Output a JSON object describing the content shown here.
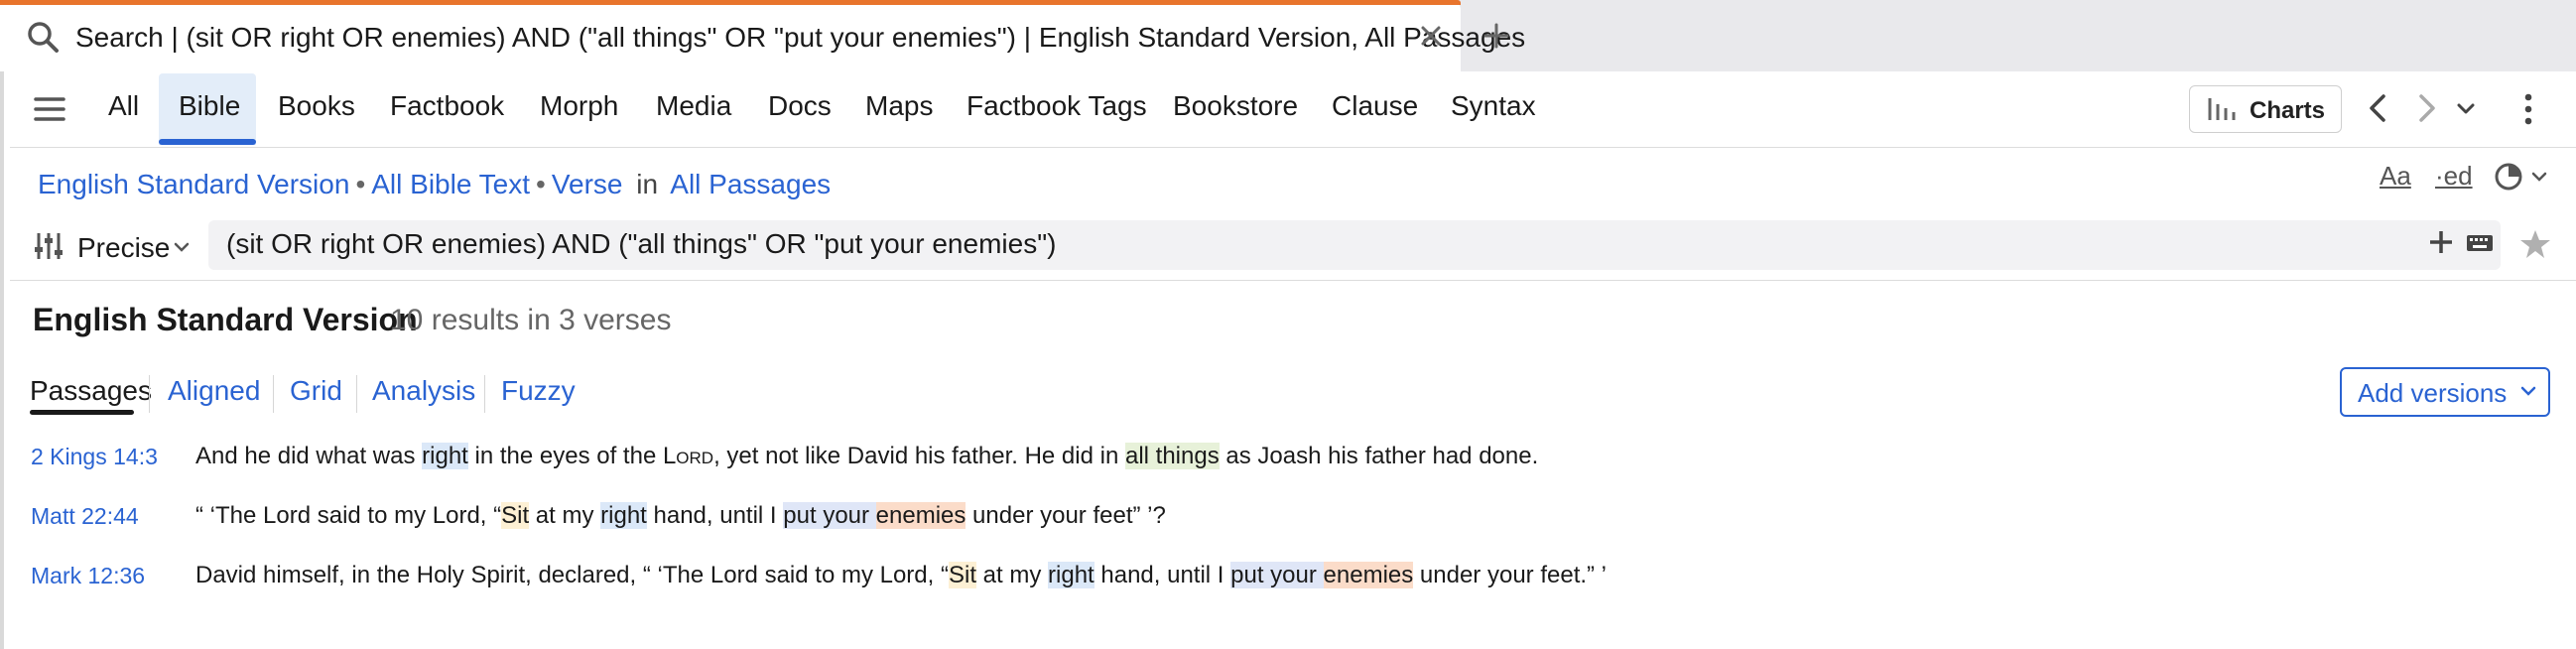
{
  "tab": {
    "title": "Search | (sit OR right OR enemies) AND (\"all things\" OR \"put your enemies\") | English Standard Version, All Passages"
  },
  "nav": {
    "tabs": [
      "All",
      "Bible",
      "Books",
      "Factbook",
      "Morph",
      "Media",
      "Docs",
      "Maps",
      "Factbook Tags",
      "Bookstore",
      "Clause",
      "Syntax"
    ],
    "active": "Bible",
    "charts_label": "Charts"
  },
  "breadcrumb": {
    "version": "English Standard Version",
    "scope": "All Bible Text",
    "unit": "Verse",
    "in_label": "in",
    "range": "All Passages"
  },
  "search": {
    "mode": "Precise",
    "query": "(sit OR right OR enemies) AND (\"all things\" OR \"put your enemies\")"
  },
  "results": {
    "title": "English Standard Version",
    "count": "10 results in 3 verses"
  },
  "view_tabs": [
    "Passages",
    "Aligned",
    "Grid",
    "Analysis",
    "Fuzzy"
  ],
  "active_view": "Passages",
  "add_versions_label": "Add versions",
  "verses": [
    {
      "ref": "2 Kings 14:3",
      "p1": "And he did what was ",
      "w1": "right",
      "p2": " in the eyes of the ",
      "lord": "Lord",
      "p3": ", yet not like David his father. He did in ",
      "w2": "all things",
      "p4": " as Joash his father had done."
    },
    {
      "ref": "Matt 22:44",
      "p1": "“ ‘The Lord said to my Lord, “",
      "w1": "Sit",
      "p2": " at my ",
      "w2": "right",
      "p3": " hand, until I ",
      "w3": "put your ",
      "w4": "enemies",
      "p4": " under your feet” ’?"
    },
    {
      "ref": "Mark 12:36",
      "p1": "David himself, in the Holy Spirit, declared, “ ‘The Lord said to my Lord, “",
      "w1": "Sit",
      "p2": " at my ",
      "w2": "right",
      "p3": " hand, until I ",
      "w3": "put your ",
      "w4": "enemies",
      "p4": " under your feet.” ’"
    }
  ],
  "colors": {
    "accent": "#2a63d2",
    "tab_accent": "#e8742c",
    "highlight_right": "#dbe8f8",
    "highlight_all_things": "#e7f1d9",
    "highlight_sit": "#fdf0d4",
    "highlight_enemies": "#fbdcc9"
  }
}
